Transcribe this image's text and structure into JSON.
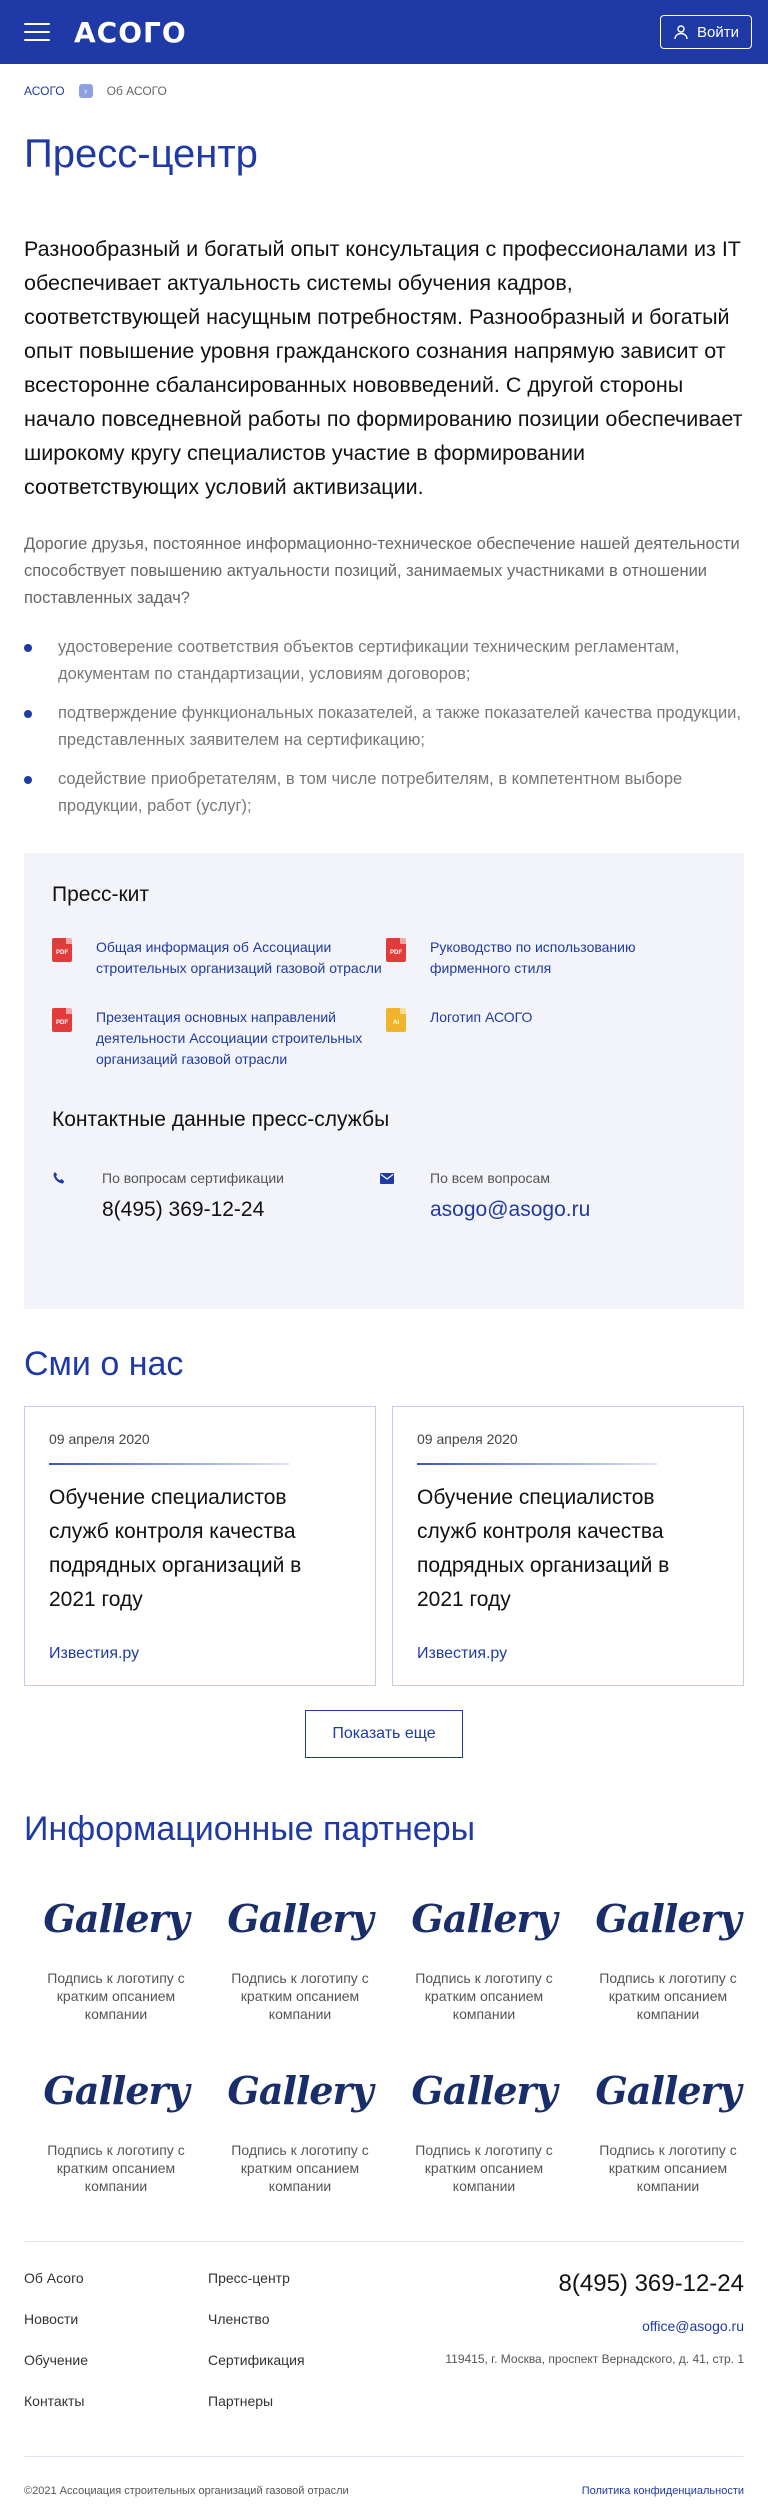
{
  "header": {
    "logo": "АСОГО",
    "login_label": "Войти"
  },
  "breadcrumb": {
    "home": "АСОГО",
    "current": "Об АСОГО"
  },
  "page": {
    "title": "Пресс-центр"
  },
  "intro": {
    "lead": "Разнообразный и богатый опыт консультация с профессионалами из IT обеспечивает актуальность системы обучения кадров, соответствующей насущным потребностям. Разнообразный и богатый опыт повышение уровня гражданского сознания напрямую зависит от всесторонне сбалансированных нововведений. С другой стороны начало повседневной работы по формированию позиции обеспечивает широкому кругу специалистов участие в формировании соответствующих условий активизации.",
    "sub": "Дорогие друзья, постоянное информационно-техническое обеспечение нашей деятельности способствует повышению актуальности позиций, занимаемых участниками в отношении поставленных задач?",
    "bullets": [
      "удостоверение соответствия объектов сертификации техническим регламентам, документам по стандартизации, условиям договоров;",
      "подтверждение функциональных показателей, а также показателей качества продукции, представленных заявителем на сертификацию;",
      "содействие приобретателям, в том числе потребителям, в компетентном выборе продукции, работ (услуг);"
    ]
  },
  "presskit": {
    "title": "Пресс-кит",
    "files": [
      {
        "type": "PDF",
        "label": "Общая информация об Ассоциации строительных организаций газовой отрасли"
      },
      {
        "type": "PDF",
        "label": "Руководство по использованию фирменного стиля"
      },
      {
        "type": "PDF",
        "label": "Презентация основных направлений деятельности Ассоциации строительных организаций газовой отрасли"
      },
      {
        "type": "AI",
        "label": "Логотип АСОГО"
      }
    ],
    "contacts_title": "Контактные данные пресс-службы",
    "phone_label": "По вопросам сертификации",
    "phone": "8(495) 369-12-24",
    "mail_label": "По всем вопросам",
    "mail": "asogo@asogo.ru"
  },
  "media": {
    "title": "Сми о нас",
    "cards": [
      {
        "date": "09 апреля 2020",
        "title": "Обучение специалистов служб контроля качества подрядных организаций в 2021 году",
        "source": "Известия.ру"
      },
      {
        "date": "09 апреля 2020",
        "title": "Обучение специалистов служб контроля качества подрядных организаций в 2021 году",
        "source": "Известия.ру"
      }
    ],
    "more_label": "Показать еще"
  },
  "partners": {
    "title": "Информационные партнеры",
    "items": [
      {
        "logo": "Gallery",
        "caption": "Подпись к логотипу с кратким опсанием компании"
      },
      {
        "logo": "Gallery",
        "caption": "Подпись к логотипу с кратким опсанием компании"
      },
      {
        "logo": "Gallery",
        "caption": "Подпись к логотипу с кратким опсанием компании"
      },
      {
        "logo": "Gallery",
        "caption": "Подпись к логотипу с кратким опсанием компании"
      },
      {
        "logo": "Gallery",
        "caption": "Подпись к логотипу с кратким опсанием компании"
      },
      {
        "logo": "Gallery",
        "caption": "Подпись к логотипу с кратким опсанием компании"
      },
      {
        "logo": "Gallery",
        "caption": "Подпись к логотипу с кратким опсанием компании"
      },
      {
        "logo": "Gallery",
        "caption": "Подпись к логотипу с кратким опсанием компании"
      }
    ]
  },
  "footer": {
    "col1": [
      "Об Асого",
      "Новости",
      "Обучение",
      "Контакты"
    ],
    "col2": [
      "Пресс-центр",
      "Членство",
      "Сертификация",
      "Партнеры"
    ],
    "phone": "8(495) 369-12-24",
    "email": "office@asogo.ru",
    "address": "119415, г. Москва, проспект Вернадского, д. 41, стр. 1",
    "copyright": "©2021 Ассоциация строительных организаций газовой отрасли",
    "policy": "Политика конфиденциальности"
  },
  "colors": {
    "brand": "#1f3aa6",
    "pdf": "#e23b3b",
    "ai": "#f0b42a",
    "panel": "#f2f4f9"
  }
}
